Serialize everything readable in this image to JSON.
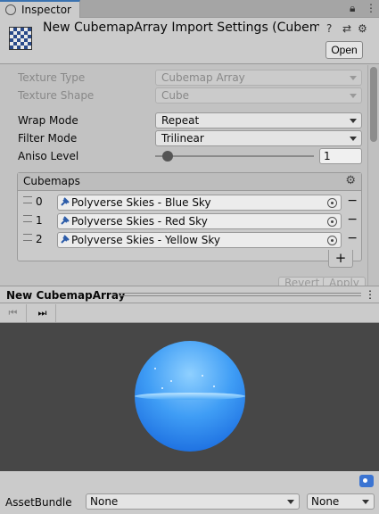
{
  "tab": {
    "label": "Inspector",
    "lock_icon": "lock-icon",
    "menu_icon": "kebab-menu-icon"
  },
  "header": {
    "title": "New CubemapArray Import Settings (Cubemap Ar",
    "open_label": "Open",
    "icons": [
      "help-icon",
      "preset-icon",
      "gear-icon"
    ]
  },
  "settings": {
    "texture_type": {
      "label": "Texture Type",
      "value": "Cubemap Array"
    },
    "texture_shape": {
      "label": "Texture Shape",
      "value": "Cube"
    },
    "wrap_mode": {
      "label": "Wrap Mode",
      "value": "Repeat"
    },
    "filter_mode": {
      "label": "Filter Mode",
      "value": "Trilinear"
    },
    "aniso_level": {
      "label": "Aniso Level",
      "value": "1",
      "slider_fraction": 0.06
    }
  },
  "cubemaps": {
    "title": "Cubemaps",
    "items": [
      {
        "index": "0",
        "value": "Polyverse Skies - Blue Sky"
      },
      {
        "index": "1",
        "value": "Polyverse Skies - Red Sky"
      },
      {
        "index": "2",
        "value": "Polyverse Skies - Yellow Sky"
      }
    ],
    "add_label": "+",
    "remove_label": "−"
  },
  "buttons": {
    "revert": "Revert",
    "apply": "Apply"
  },
  "preview": {
    "title": "New CubemapArray"
  },
  "asset_bundle": {
    "label": "AssetBundle",
    "name": "None",
    "variant": "None"
  },
  "colors": {
    "accent": "#3a72b0",
    "viewport_bg": "#474747",
    "sphere": "#3f9df5"
  }
}
